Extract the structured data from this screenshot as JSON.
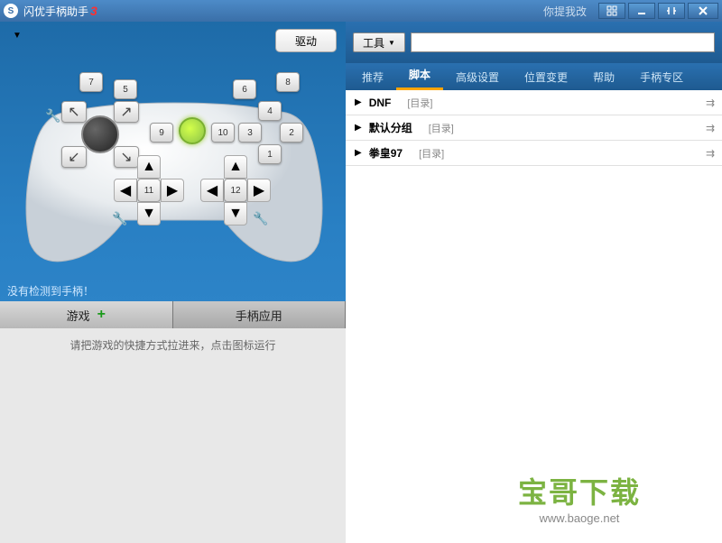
{
  "titlebar": {
    "app": "闪优手柄助手",
    "version": "3",
    "feedback": "你提我改"
  },
  "driver_btn": "驱动",
  "controller": {
    "shoulders": {
      "l1": "7",
      "l2": "5",
      "r1": "6",
      "r2": "8"
    },
    "face": {
      "a": "1",
      "b": "2",
      "x": "3",
      "y": "4"
    },
    "mid": {
      "back": "9",
      "start": "10"
    },
    "sticks": {
      "l": "11",
      "r": "12"
    }
  },
  "status": "没有检测到手柄！",
  "tabs2": {
    "game": "游戏",
    "app": "手柄应用"
  },
  "dropzone_hint": "请把游戏的快捷方式拉进来，点击图标运行",
  "toolbar": {
    "tools": "工具"
  },
  "navtabs": [
    "推荐",
    "脚本",
    "高级设置",
    "位置变更",
    "帮助",
    "手柄专区"
  ],
  "navtabs_active": 1,
  "list": [
    {
      "name": "DNF",
      "cat": "[目录]"
    },
    {
      "name": "默认分组",
      "cat": "[目录]"
    },
    {
      "name": "拳皇97",
      "cat": "[目录]"
    }
  ],
  "watermark": {
    "text": "宝哥下载",
    "url": "www.baoge.net"
  }
}
